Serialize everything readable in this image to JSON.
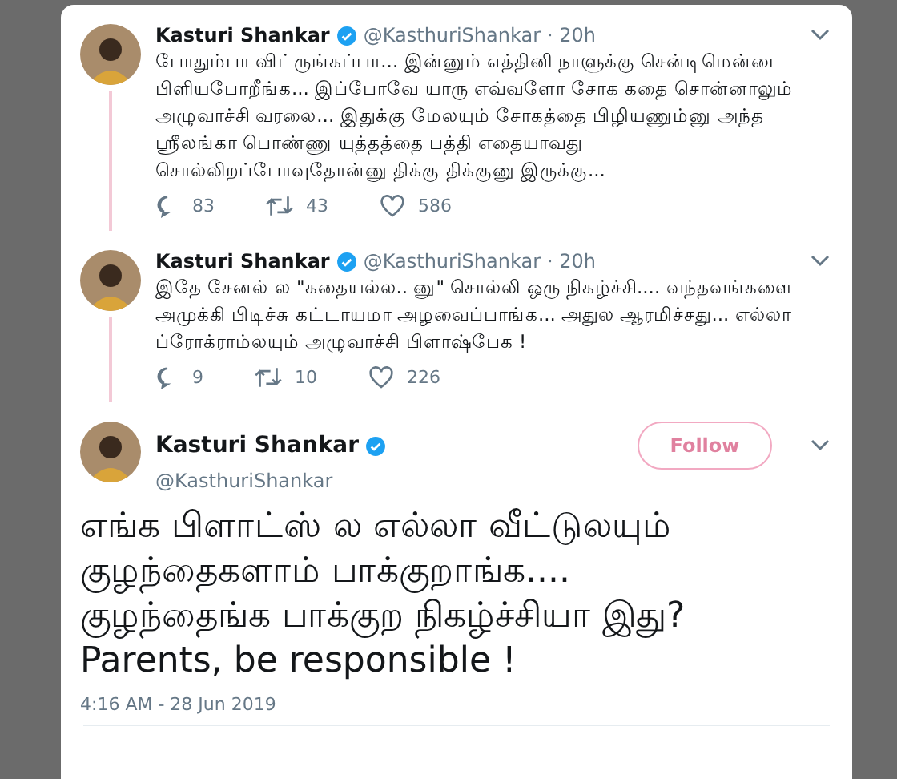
{
  "thread": [
    {
      "name": "Kasturi Shankar",
      "handle": "@KasthuriShankar",
      "time": "· 20h",
      "text": "போதும்பா விட்ருங்கப்பா... இன்னும் எத்தினி நாளுக்கு சென்டிமென்டை பிளியபோறீங்க... இப்போவே யாரு எவ்வளோ சோக கதை சொன்னாலும் அழுவாச்சி வரலை... இதுக்கு மேலயும் சோகத்தை பிழியணும்னு அந்த ஸ்ரீலங்கா பொண்ணு யுத்தத்தை பத்தி எதையாவது சொல்லிறப்போவுதோன்னு திக்கு திக்குனு இருக்கு...",
      "replies": "83",
      "retweets": "43",
      "likes": "586"
    },
    {
      "name": "Kasturi Shankar",
      "handle": "@KasthuriShankar",
      "time": "· 20h",
      "text": "இதே சேனல் ல \"கதையல்ல.. னு\" சொல்லி ஒரு நிகழ்ச்சி.... வந்தவங்களை அமுக்கி பிடிச்சு கட்டாயமா அழவைப்பாங்க... அதுல ஆரமிச்சது... எல்லா ப்ரோக்ராம்லயும் அழுவாச்சி பிளாஷ்பேக !",
      "replies": "9",
      "retweets": "10",
      "likes": "226"
    }
  ],
  "main": {
    "name": "Kasturi Shankar",
    "handle": "@KasthuriShankar",
    "follow": "Follow",
    "text": "எங்க பிளாட்ஸ் ல எல்லா வீட்டுலயும் குழந்தைகளாம் பாக்குறாங்க.... குழந்தைங்க பாக்குற நிகழ்ச்சியா இது? Parents, be responsible !",
    "timestamp": "4:16 AM - 28 Jun 2019"
  }
}
